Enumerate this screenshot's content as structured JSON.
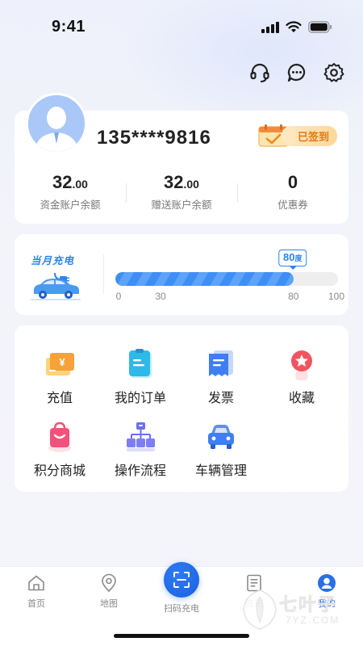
{
  "status_bar": {
    "time": "9:41"
  },
  "header": {
    "icons": [
      "headset-icon",
      "chat-icon",
      "gear-icon"
    ]
  },
  "profile": {
    "phone": "135****9816",
    "signin_label": "已签到",
    "stats": [
      {
        "value": "32",
        "decimal": ".00",
        "label": "资金账户余额"
      },
      {
        "value": "32",
        "decimal": ".00",
        "label": "赠送账户余额"
      },
      {
        "value": "0",
        "decimal": "",
        "label": "优惠券"
      }
    ]
  },
  "charge": {
    "title": "当月充电",
    "badge_value": "80",
    "badge_unit": "度",
    "current": 80,
    "max": 100,
    "ticks": [
      "0",
      "30",
      "80",
      "100"
    ]
  },
  "menu": [
    {
      "label": "充值",
      "icon": "recharge-icon"
    },
    {
      "label": "我的订单",
      "icon": "order-icon"
    },
    {
      "label": "发票",
      "icon": "invoice-icon"
    },
    {
      "label": "收藏",
      "icon": "favorite-icon"
    },
    {
      "label": "积分商城",
      "icon": "shop-bag-icon"
    },
    {
      "label": "操作流程",
      "icon": "flow-icon"
    },
    {
      "label": "车辆管理",
      "icon": "car-icon"
    }
  ],
  "tabs": [
    {
      "label": "首页",
      "icon": "home-icon"
    },
    {
      "label": "地图",
      "icon": "map-pin-icon"
    },
    {
      "label": "扫码充电",
      "icon": "scan-icon"
    },
    {
      "label": "资讯",
      "icon": "news-icon"
    },
    {
      "label": "我的",
      "icon": "profile-icon"
    }
  ],
  "watermark": {
    "text": "七叶子",
    "sub": "7YZ.COM"
  },
  "colors": {
    "accent": "#2a86ea",
    "tab_active": "#2a6ee8",
    "signin": "#e07b13"
  }
}
